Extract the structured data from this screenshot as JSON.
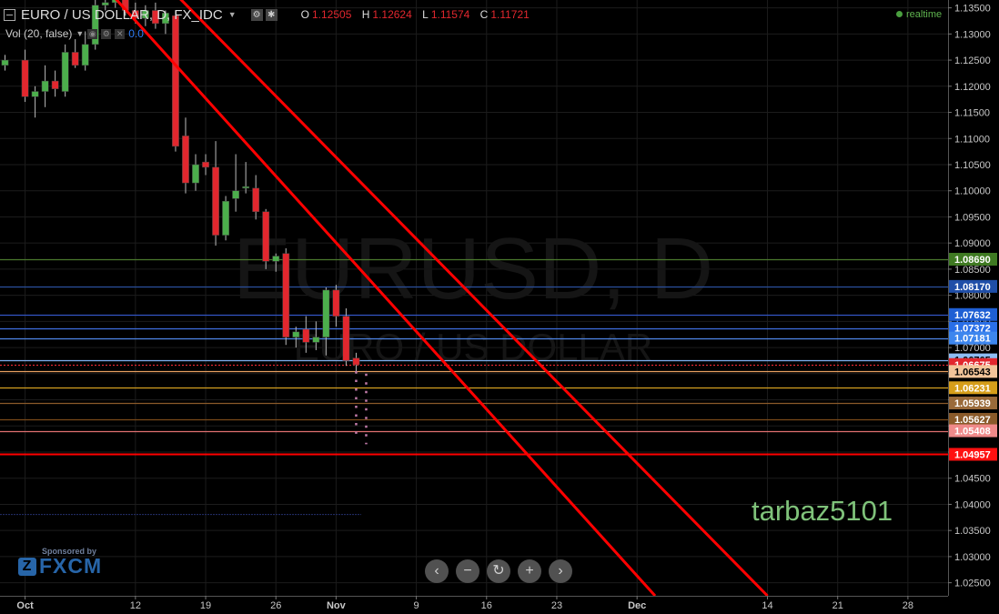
{
  "header": {
    "title": "EURO / US DOLLAR, D, FX_IDC",
    "open_label": "O",
    "open": "1.12505",
    "high_label": "H",
    "high": "1.12624",
    "low_label": "L",
    "low": "1.11574",
    "close_label": "C",
    "close": "1.11721",
    "realtime": "realtime"
  },
  "volume_indicator": {
    "label": "Vol (20, false)",
    "value": "0.0"
  },
  "watermark": {
    "symbol": "EURUSD, D",
    "name": "EURO / US DOLLAR"
  },
  "signature": "tarbaz5101",
  "sponsor": {
    "line1": "Sponsored by",
    "brand": "FXCM"
  },
  "nav_buttons": {
    "left": "‹",
    "zoom_out": "−",
    "reset": "↻",
    "zoom_in": "+",
    "right": "›"
  },
  "colors": {
    "up": "#4cae4c",
    "down": "#e2272e",
    "trend": "#ff0000",
    "background": "#000000"
  },
  "chart_data": {
    "type": "candlestick",
    "x_ticks": [
      {
        "label": "Oct",
        "day": 0
      },
      {
        "label": "12",
        "day": 11
      },
      {
        "label": "19",
        "day": 18
      },
      {
        "label": "26",
        "day": 25
      },
      {
        "label": "Nov",
        "day": 31
      },
      {
        "label": "9",
        "day": 39
      },
      {
        "label": "16",
        "day": 46
      },
      {
        "label": "23",
        "day": 53
      },
      {
        "label": "Dec",
        "day": 61
      },
      {
        "label": "14",
        "day": 74
      },
      {
        "label": "21",
        "day": 81
      },
      {
        "label": "28",
        "day": 88
      }
    ],
    "y_ticks": [
      "1.13500",
      "1.13000",
      "1.12500",
      "1.12000",
      "1.11500",
      "1.11000",
      "1.10500",
      "1.10000",
      "1.09500",
      "1.09000",
      "1.08500",
      "1.08000",
      "1.07500",
      "1.07000",
      "1.06500",
      "1.06000",
      "1.05500",
      "1.05000",
      "1.04500",
      "1.04000",
      "1.03500",
      "1.03000",
      "1.02500"
    ],
    "ylim": [
      1.0225,
      1.1365
    ],
    "xlim": [
      -2.5,
      92
    ],
    "candles": [
      {
        "day": -2,
        "o": 1.124,
        "h": 1.126,
        "l": 1.123,
        "c": 1.125
      },
      {
        "day": 0,
        "o": 1.125,
        "h": 1.127,
        "l": 1.117,
        "c": 1.118
      },
      {
        "day": 1,
        "o": 1.118,
        "h": 1.12,
        "l": 1.114,
        "c": 1.119
      },
      {
        "day": 2,
        "o": 1.119,
        "h": 1.124,
        "l": 1.116,
        "c": 1.121
      },
      {
        "day": 3,
        "o": 1.121,
        "h": 1.123,
        "l": 1.118,
        "c": 1.1195
      },
      {
        "day": 4,
        "o": 1.119,
        "h": 1.128,
        "l": 1.118,
        "c": 1.1265
      },
      {
        "day": 5,
        "o": 1.1265,
        "h": 1.129,
        "l": 1.1235,
        "c": 1.124
      },
      {
        "day": 6,
        "o": 1.124,
        "h": 1.1305,
        "l": 1.123,
        "c": 1.128
      },
      {
        "day": 7,
        "o": 1.128,
        "h": 1.1375,
        "l": 1.127,
        "c": 1.1355
      },
      {
        "day": 8,
        "o": 1.1355,
        "h": 1.138,
        "l": 1.1345,
        "c": 1.136
      },
      {
        "day": 9,
        "o": 1.136,
        "h": 1.139,
        "l": 1.135,
        "c": 1.137
      },
      {
        "day": 10,
        "o": 1.1385,
        "h": 1.1395,
        "l": 1.1335,
        "c": 1.1345
      },
      {
        "day": 11,
        "o": 1.1345,
        "h": 1.136,
        "l": 1.132,
        "c": 1.133
      },
      {
        "day": 12,
        "o": 1.133,
        "h": 1.1355,
        "l": 1.1315,
        "c": 1.1345
      },
      {
        "day": 13,
        "o": 1.1345,
        "h": 1.136,
        "l": 1.131,
        "c": 1.132
      },
      {
        "day": 14,
        "o": 1.132,
        "h": 1.1345,
        "l": 1.13,
        "c": 1.134
      },
      {
        "day": 15,
        "o": 1.1335,
        "h": 1.1345,
        "l": 1.1075,
        "c": 1.1085
      },
      {
        "day": 16,
        "o": 1.1105,
        "h": 1.114,
        "l": 1.0995,
        "c": 1.1015
      },
      {
        "day": 17,
        "o": 1.1015,
        "h": 1.107,
        "l": 1.1,
        "c": 1.105
      },
      {
        "day": 18,
        "o": 1.1055,
        "h": 1.107,
        "l": 1.103,
        "c": 1.1045
      },
      {
        "day": 19,
        "o": 1.1045,
        "h": 1.1095,
        "l": 1.0895,
        "c": 1.0915
      },
      {
        "day": 20,
        "o": 1.0915,
        "h": 1.099,
        "l": 1.0905,
        "c": 1.098
      },
      {
        "day": 21,
        "o": 1.0985,
        "h": 1.107,
        "l": 1.096,
        "c": 1.1
      },
      {
        "day": 22,
        "o": 1.1005,
        "h": 1.1055,
        "l": 1.0995,
        "c": 1.1008
      },
      {
        "day": 23,
        "o": 1.1005,
        "h": 1.103,
        "l": 1.0945,
        "c": 1.096
      },
      {
        "day": 24,
        "o": 1.096,
        "h": 1.0965,
        "l": 1.085,
        "c": 1.0865
      },
      {
        "day": 25,
        "o": 1.0865,
        "h": 1.088,
        "l": 1.0845,
        "c": 1.0875
      },
      {
        "day": 26,
        "o": 1.088,
        "h": 1.089,
        "l": 1.0705,
        "c": 1.072
      },
      {
        "day": 27,
        "o": 1.072,
        "h": 1.074,
        "l": 1.07,
        "c": 1.073
      },
      {
        "day": 28,
        "o": 1.0735,
        "h": 1.076,
        "l": 1.069,
        "c": 1.071
      },
      {
        "day": 29,
        "o": 1.071,
        "h": 1.075,
        "l": 1.0695,
        "c": 1.072
      },
      {
        "day": 30,
        "o": 1.072,
        "h": 1.0815,
        "l": 1.0685,
        "c": 1.081
      },
      {
        "day": 31,
        "o": 1.081,
        "h": 1.082,
        "l": 1.074,
        "c": 1.076
      },
      {
        "day": 32,
        "o": 1.076,
        "h": 1.0775,
        "l": 1.0665,
        "c": 1.0675
      },
      {
        "day": 33,
        "o": 1.068,
        "h": 1.069,
        "l": 1.065,
        "c": 1.0667
      }
    ],
    "levels": [
      {
        "value": "1.08690",
        "y": 1.0869,
        "color": "#4b7a2e",
        "label_bg": "#3f7a22",
        "label_fg": "#ffffff"
      },
      {
        "value": "1.08170",
        "y": 1.0817,
        "color": "#2a4f9c",
        "label_bg": "#1f4ea8",
        "label_fg": "#ffffff"
      },
      {
        "value": "1.07632",
        "y": 1.07632,
        "color": "#3355c4",
        "label_bg": "#1f5fd4",
        "label_fg": "#ffffff"
      },
      {
        "value": "1.07372",
        "y": 1.07372,
        "color": "#3f6ee0",
        "label_bg": "#2a6fe8",
        "label_fg": "#ffffff"
      },
      {
        "value": "1.07181",
        "y": 1.07181,
        "color": "#4f86e8",
        "label_bg": "#3d86ee",
        "label_fg": "#ffffff"
      },
      {
        "value": "1.06765",
        "y": 1.06765,
        "color": "#7fb0f0",
        "label_bg": "#8ebdf4",
        "label_fg": "#000000"
      },
      {
        "value": "1.06675",
        "y": 1.06675,
        "color": "#e2272e",
        "label_bg": "#e2272e",
        "label_fg": "#ffffff",
        "dotted": true
      },
      {
        "value": "1.06543",
        "y": 1.06543,
        "color": "#e8a060",
        "label_bg": "#f2c49a",
        "label_fg": "#000000"
      },
      {
        "value": "1.06231",
        "y": 1.06231,
        "color": "#d4a020",
        "label_bg": "#d69e1a",
        "label_fg": "#ffffff"
      },
      {
        "value": "1.05939",
        "y": 1.05939,
        "color": "#8a5a2a",
        "label_bg": "#9a6a3a",
        "label_fg": "#ffffff"
      },
      {
        "value": "1.05627",
        "y": 1.05627,
        "color": "#7a4a1a",
        "label_bg": "#8a5a2a",
        "label_fg": "#ffffff"
      },
      {
        "value": "1.05408",
        "y": 1.05408,
        "color": "#e07070",
        "label_bg": "#f08a8a",
        "label_fg": "#ffffff"
      },
      {
        "value": "1.04957",
        "y": 1.04957,
        "color": "#ff0000",
        "label_bg": "#ff1010",
        "label_fg": "#ffffff"
      }
    ],
    "trendlines": [
      {
        "from": {
          "day": 4.2,
          "y": 1.147
        },
        "to": {
          "day": 62.8,
          "y": 1.0225
        }
      },
      {
        "from": {
          "day": 12.5,
          "y": 1.1425
        },
        "to": {
          "day": 74.0,
          "y": 1.0225
        }
      }
    ],
    "dotted_projection": [
      {
        "day": 33.0,
        "from": 1.0655,
        "to": 1.0535
      },
      {
        "day": 34.0,
        "from": 1.065,
        "to": 1.0515
      }
    ],
    "faint_level": {
      "y": 1.03806,
      "day_from": -2.5,
      "day_to": 33.5,
      "color": "#24306e"
    },
    "grid": true
  }
}
